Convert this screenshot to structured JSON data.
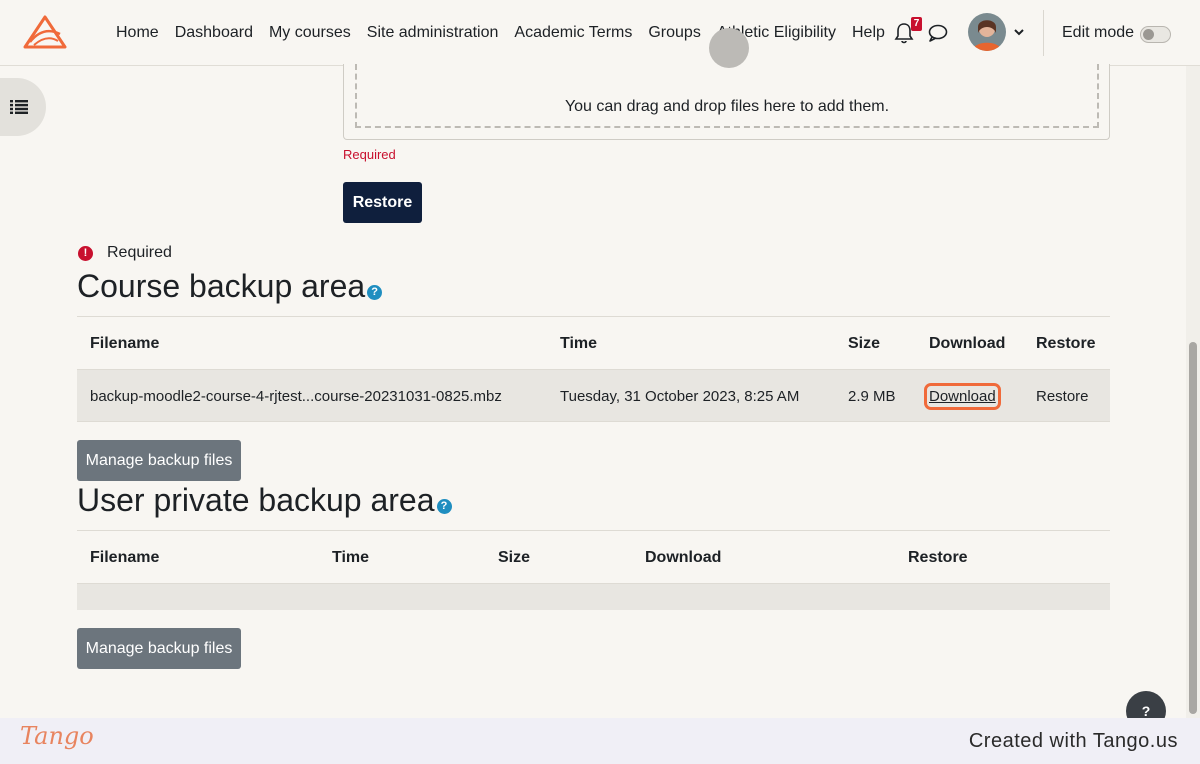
{
  "nav": {
    "items": [
      {
        "label": "Home"
      },
      {
        "label": "Dashboard"
      },
      {
        "label": "My courses"
      },
      {
        "label": "Site administration"
      },
      {
        "label": "Academic Terms"
      },
      {
        "label": "Groups"
      },
      {
        "label": "Athletic Eligibility"
      },
      {
        "label": "Help"
      }
    ],
    "notification_count": "7",
    "edit_mode_label": "Edit mode",
    "edit_mode_on": false
  },
  "filepicker": {
    "drop_text": "You can drag and drop files here to add them.",
    "required_text": "Required",
    "restore_label": "Restore"
  },
  "required_note": "Required",
  "course_backup": {
    "title": "Course backup area",
    "columns": [
      "Filename",
      "Time",
      "Size",
      "Download",
      "Restore"
    ],
    "rows": [
      {
        "filename": "backup-moodle2-course-4-rjtest...course-20231031-0825.mbz",
        "time": "Tuesday, 31 October 2023, 8:25 AM",
        "size": "2.9 MB",
        "download": "Download",
        "restore": "Restore"
      }
    ],
    "manage_label": "Manage backup files"
  },
  "user_backup": {
    "title": "User private backup area",
    "columns": [
      "Filename",
      "Time",
      "Size",
      "Download",
      "Restore"
    ],
    "manage_label": "Manage backup files"
  },
  "help_fab_label": "?",
  "footer": {
    "brand": "Tango",
    "created_with": "Created with Tango.us"
  },
  "colors": {
    "accent": "#f06a3a",
    "primary_button": "#0f1f3d",
    "secondary_button": "#6c757d",
    "required": "#c8102e",
    "help": "#1f8ec0"
  }
}
